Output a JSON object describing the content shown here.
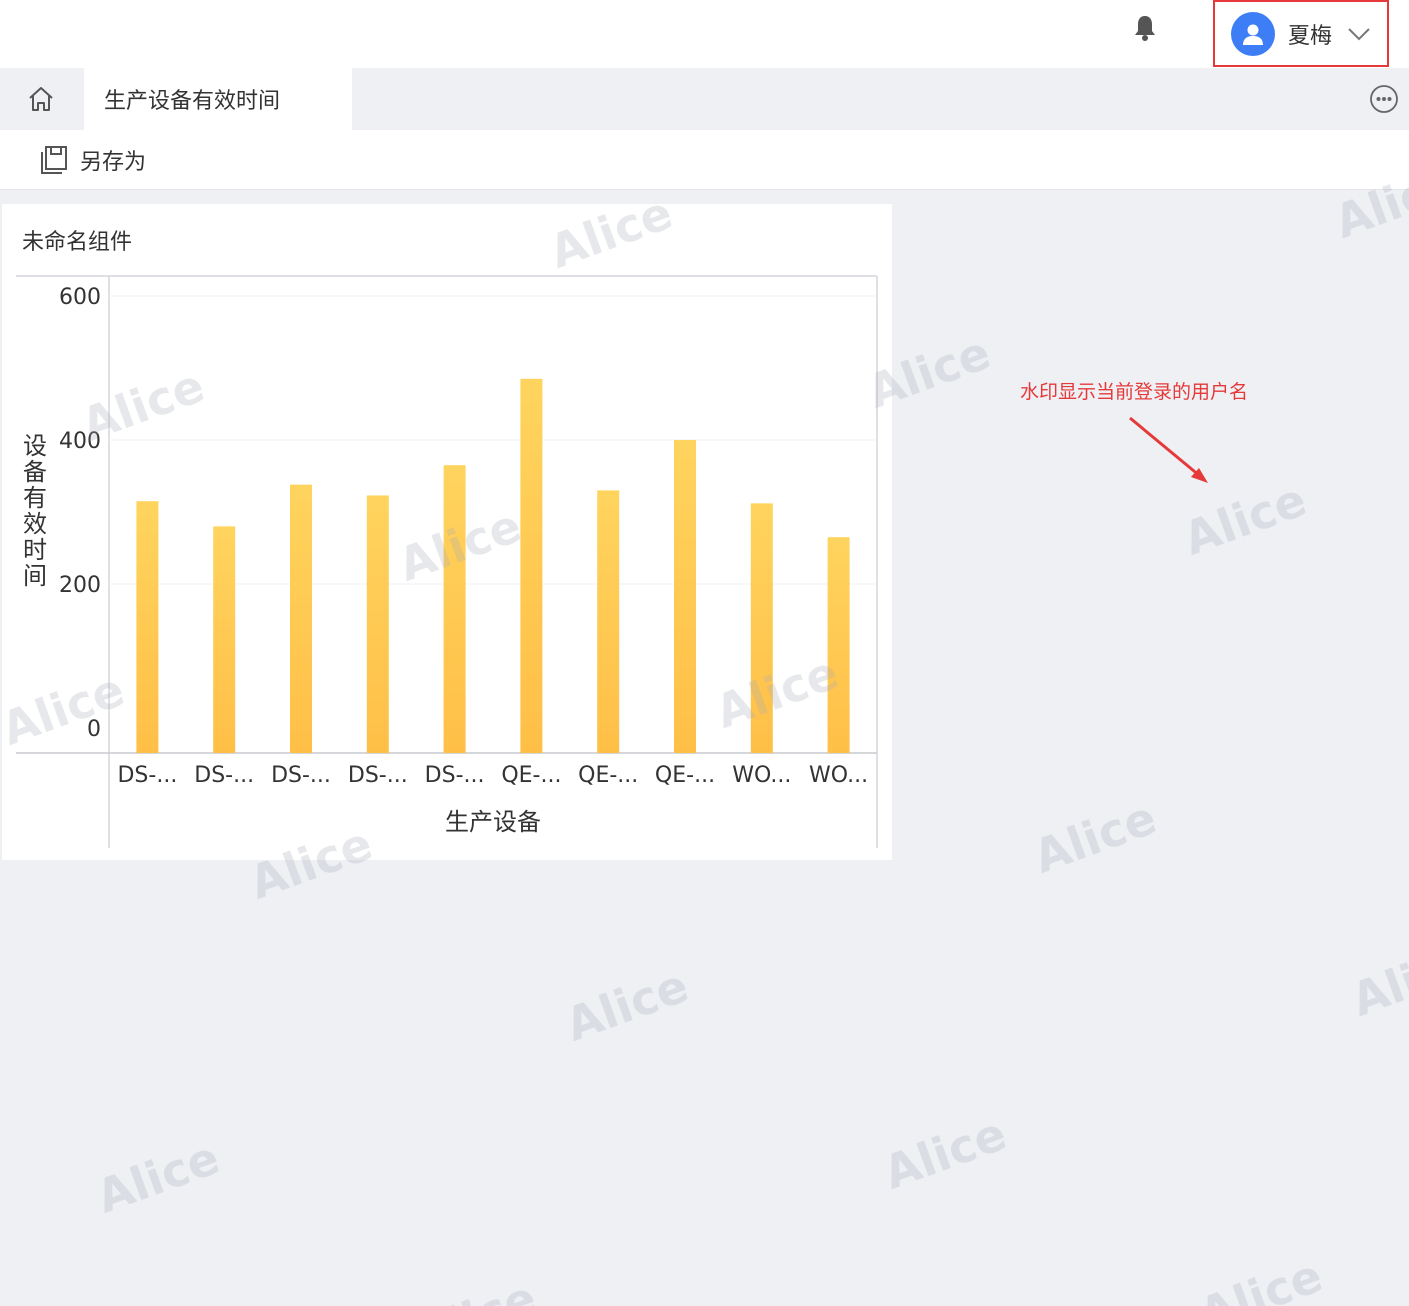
{
  "header": {
    "username": "夏梅",
    "bell_icon": "bell-icon",
    "avatar_icon": "user-avatar-icon",
    "dropdown_icon": "chevron-down-icon"
  },
  "tabs": {
    "home_icon": "home-icon",
    "active_label": "生产设备有效时间",
    "more_icon": "more-icon"
  },
  "toolbar": {
    "save_as_label": "另存为",
    "save_as_icon": "save-as-icon"
  },
  "widget": {
    "title": "未命名组件"
  },
  "chart_data": {
    "type": "bar",
    "categories": [
      "DS-...",
      "DS-...",
      "DS-...",
      "DS-...",
      "DS-...",
      "QE-...",
      "QE-...",
      "QE-...",
      "WO...",
      "WO..."
    ],
    "values": [
      315,
      280,
      338,
      323,
      365,
      485,
      330,
      400,
      312,
      265
    ],
    "xlabel": "生产设备",
    "ylabel": "设备有效时间",
    "ylim": [
      0,
      600
    ],
    "yticks": [
      0,
      200,
      400,
      600
    ],
    "grid": true,
    "bar_color_top": "#ffd45e",
    "bar_color_bottom": "#ffbf47"
  },
  "annotation": {
    "text": "水印显示当前登录的用户名",
    "color": "#e5393a"
  },
  "watermark": {
    "text": "Alice"
  },
  "colors": {
    "accent": "#3d7ef7",
    "highlight_border": "#e5393a",
    "page_bg": "#eef0f4"
  }
}
